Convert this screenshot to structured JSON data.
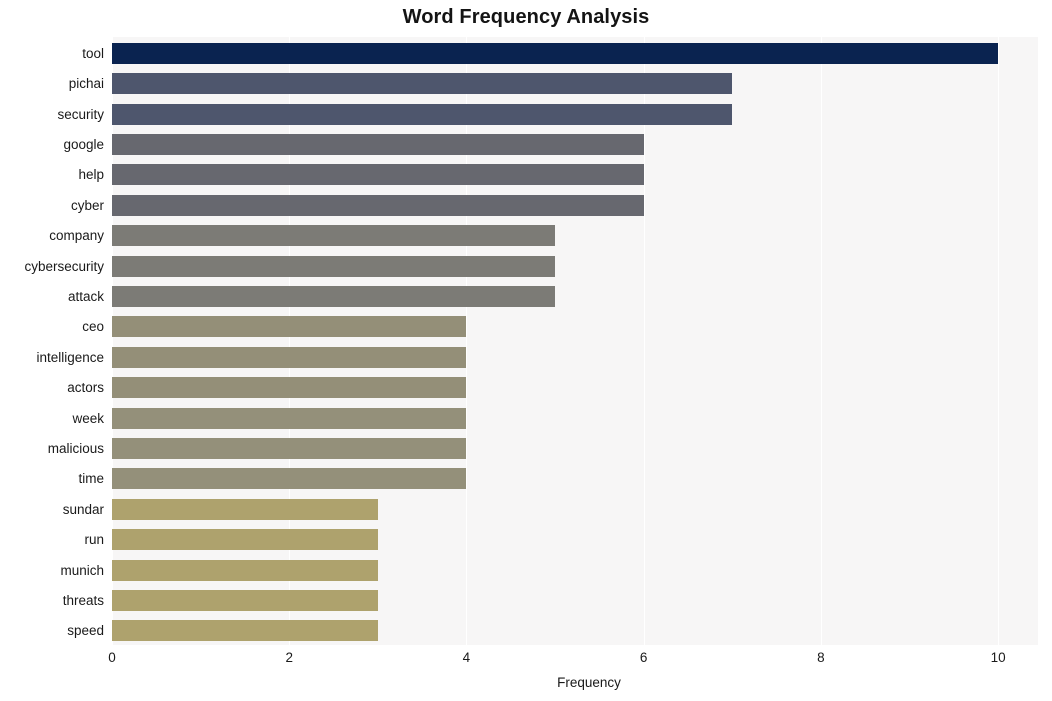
{
  "chart_data": {
    "type": "bar",
    "orientation": "horizontal",
    "title": "Word Frequency Analysis",
    "xlabel": "Frequency",
    "ylabel": "",
    "xlim": [
      0,
      10.45
    ],
    "xticks": [
      0,
      2,
      4,
      6,
      8,
      10
    ],
    "xtick_labels": [
      "0",
      "2",
      "4",
      "6",
      "8",
      "10"
    ],
    "grid": true,
    "grid_axis": "x",
    "legend": "none",
    "categories": [
      "tool",
      "pichai",
      "security",
      "google",
      "help",
      "cyber",
      "company",
      "cybersecurity",
      "attack",
      "ceo",
      "intelligence",
      "actors",
      "week",
      "malicious",
      "time",
      "sundar",
      "run",
      "munich",
      "threats",
      "speed"
    ],
    "values": [
      10,
      7,
      7,
      6,
      6,
      6,
      5,
      5,
      5,
      4,
      4,
      4,
      4,
      4,
      4,
      3,
      3,
      3,
      3,
      3
    ],
    "bar_colors": [
      "#0a2350",
      "#4e566d",
      "#4e566d",
      "#67686f",
      "#67686f",
      "#67686f",
      "#7c7b76",
      "#7c7b76",
      "#7c7b76",
      "#948f78",
      "#948f78",
      "#948f78",
      "#94907a",
      "#94907a",
      "#94907a",
      "#aea26d",
      "#aea26d",
      "#aea26d",
      "#aea26d",
      "#aea26d"
    ],
    "bars": [
      {
        "label": "tool",
        "value": 10,
        "color": "#0a2350"
      },
      {
        "label": "pichai",
        "value": 7,
        "color": "#4e566d"
      },
      {
        "label": "security",
        "value": 7,
        "color": "#4e566d"
      },
      {
        "label": "google",
        "value": 6,
        "color": "#67686f"
      },
      {
        "label": "help",
        "value": 6,
        "color": "#67686f"
      },
      {
        "label": "cyber",
        "value": 6,
        "color": "#67686f"
      },
      {
        "label": "company",
        "value": 5,
        "color": "#7c7b76"
      },
      {
        "label": "cybersecurity",
        "value": 5,
        "color": "#7c7b76"
      },
      {
        "label": "attack",
        "value": 5,
        "color": "#7c7b76"
      },
      {
        "label": "ceo",
        "value": 4,
        "color": "#948f78"
      },
      {
        "label": "intelligence",
        "value": 4,
        "color": "#948f78"
      },
      {
        "label": "actors",
        "value": 4,
        "color": "#948f78"
      },
      {
        "label": "week",
        "value": 4,
        "color": "#94907a"
      },
      {
        "label": "malicious",
        "value": 4,
        "color": "#94907a"
      },
      {
        "label": "time",
        "value": 4,
        "color": "#94907a"
      },
      {
        "label": "sundar",
        "value": 3,
        "color": "#aea26d"
      },
      {
        "label": "run",
        "value": 3,
        "color": "#aea26d"
      },
      {
        "label": "munich",
        "value": 3,
        "color": "#aea26d"
      },
      {
        "label": "threats",
        "value": 3,
        "color": "#aea26d"
      },
      {
        "label": "speed",
        "value": 3,
        "color": "#aea26d"
      }
    ],
    "plot_background": "#f7f6f6",
    "figure_background": "#ffffff",
    "gridline_color": "#ffffff",
    "title_color": "#141414",
    "tick_label_color": "#1a1a1a"
  }
}
